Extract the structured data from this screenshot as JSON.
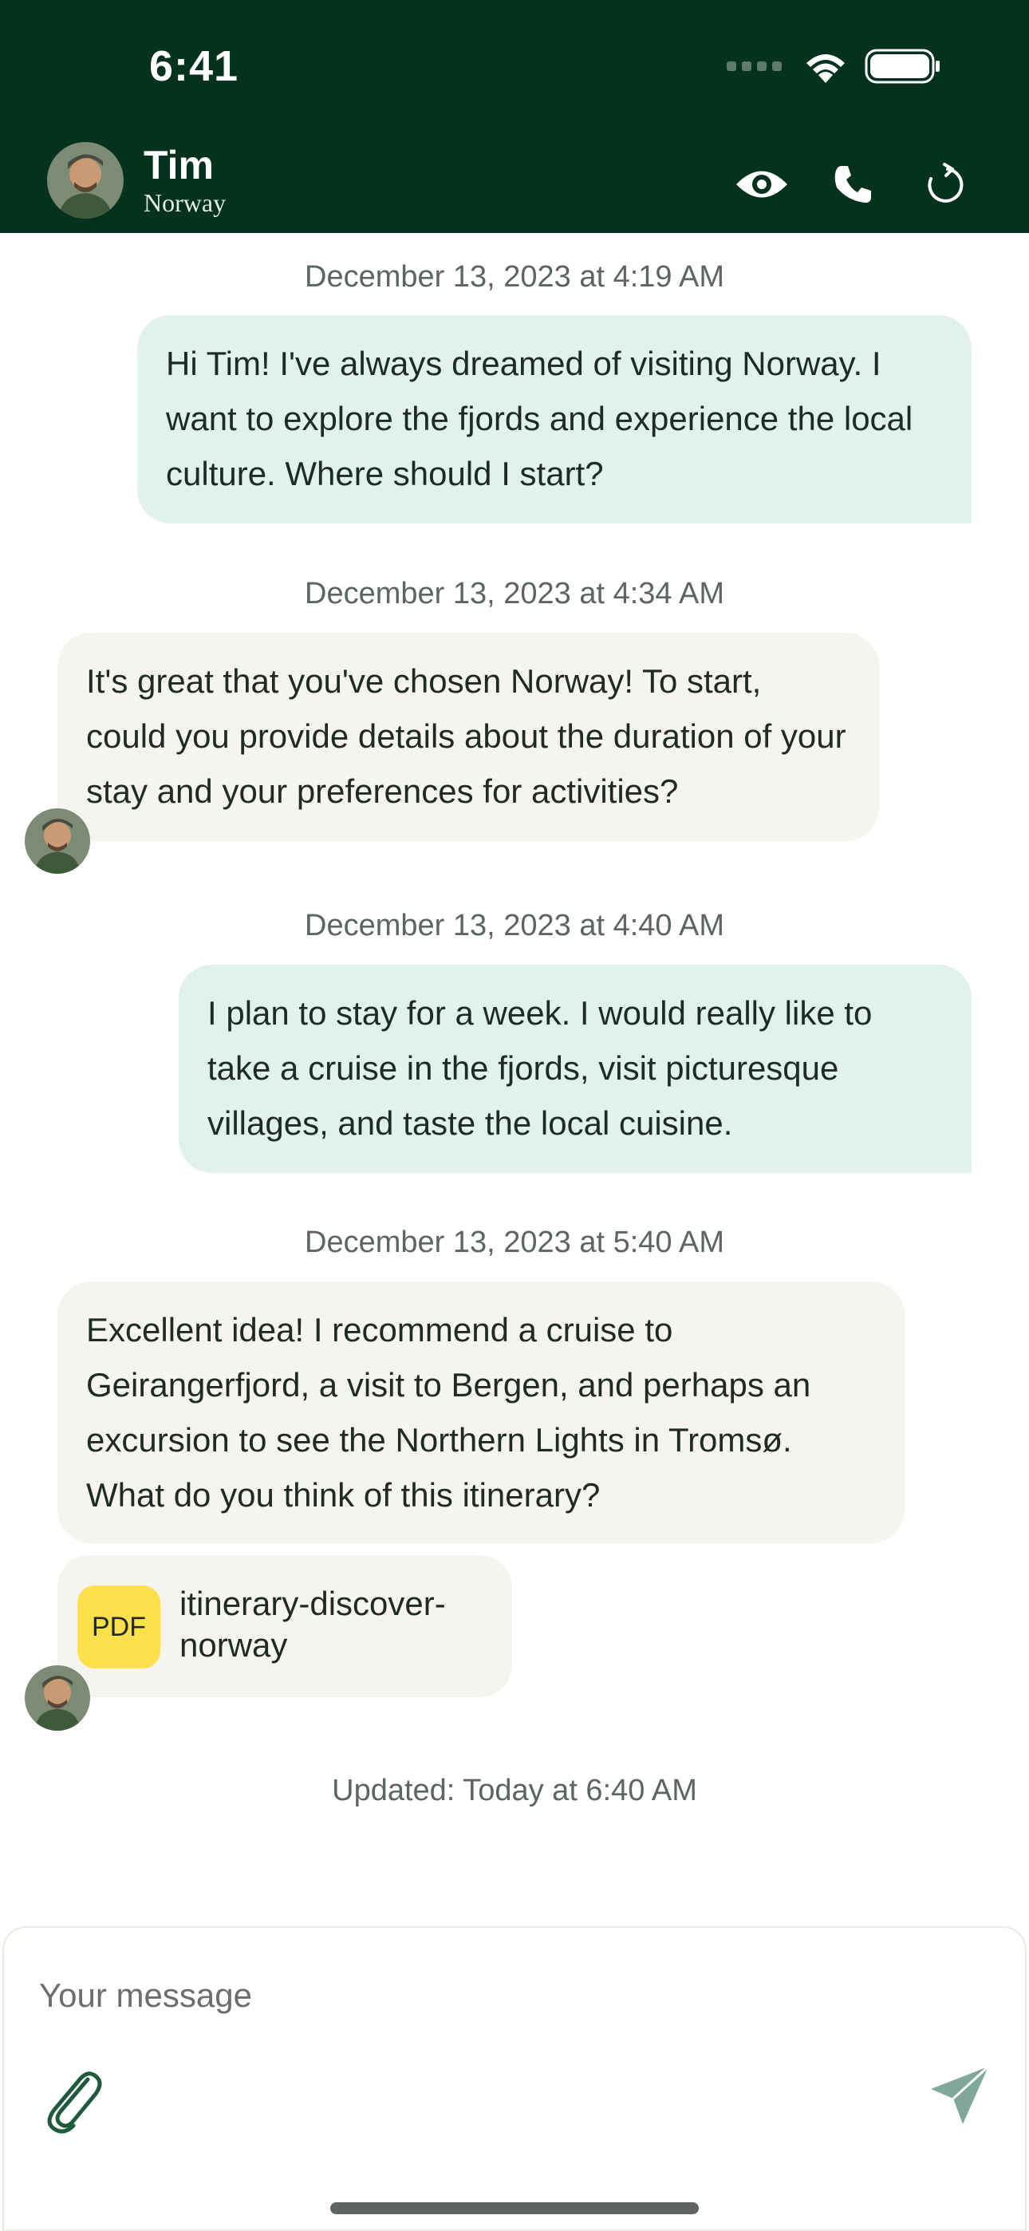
{
  "status_bar": {
    "time": "6:41"
  },
  "header": {
    "contact_name": "Tim",
    "contact_subtitle": "Norway"
  },
  "messages": [
    {
      "timestamp": "December 13, 2023 at 4:19 AM",
      "direction": "outgoing",
      "text": "Hi Tim! I've always dreamed of visiting Norway. I want to explore the fjords and experience the local culture. Where should I start?"
    },
    {
      "timestamp": "December 13, 2023 at 4:34 AM",
      "direction": "incoming",
      "text": "It's great that you've chosen Norway! To start, could you provide details about the duration of your stay and your preferences for activities?"
    },
    {
      "timestamp": "December 13, 2023 at 4:40 AM",
      "direction": "outgoing",
      "text": "I plan to stay for a week. I would really like to take a cruise in the fjords, visit picturesque villages, and taste the local cuisine."
    },
    {
      "timestamp": "December 13, 2023 at 5:40 AM",
      "direction": "incoming",
      "text": "Excellent idea! I recommend a cruise to Geirangerfjord, a visit to Bergen, and perhaps an excursion to see the Northern Lights in Tromsø. What do you think of this itinerary?"
    }
  ],
  "attachment": {
    "type_label": "PDF",
    "file_name": "itinerary-discover-norway"
  },
  "updated_text": "Updated: Today at 6:40 AM",
  "composer": {
    "placeholder": "Your message"
  },
  "colors": {
    "header_bg": "#04321f",
    "outgoing_bubble": "#e1f1ec",
    "incoming_bubble": "#f6f4ee",
    "pdf_badge": "#fde04b",
    "send_icon": "#7fa899"
  },
  "icons": [
    "eye-icon",
    "phone-icon",
    "refresh-icon",
    "paperclip-icon",
    "send-icon"
  ]
}
